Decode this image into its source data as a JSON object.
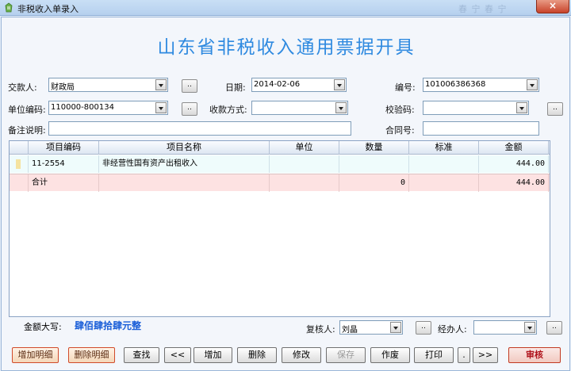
{
  "window": {
    "title": "非税收入单录入",
    "ghost_text": "春  宁  春  宁",
    "close_label": "×"
  },
  "header": {
    "title": "山东省非税收入通用票据开具"
  },
  "form": {
    "payer_label": "交款人:",
    "payer_value": "财政局",
    "date_label": "日期:",
    "date_value": "2014-02-06",
    "number_label": "编号:",
    "number_value": "101006386368",
    "unit_code_label": "单位编码:",
    "unit_code_value": "110000-800134",
    "pay_method_label": "收款方式:",
    "pay_method_value": "",
    "checksum_label": "校验码:",
    "checksum_value": "",
    "remark_label": "备注说明:",
    "remark_value": "",
    "contract_label": "合同号:",
    "contract_value": "",
    "dots": ".."
  },
  "grid": {
    "columns": [
      "项目编码",
      "项目名称",
      "单位",
      "数量",
      "标准",
      "金额"
    ],
    "row": {
      "marker": "I",
      "code": "11-2554",
      "name": "非经营性国有资产出租收入",
      "unit": "",
      "qty": "",
      "standard": "",
      "amount": "444.00"
    },
    "total": {
      "label": "合计",
      "qty": "0",
      "amount": "444.00"
    }
  },
  "summary": {
    "amount_upper_label": "金额大写:",
    "amount_upper_value": "肆佰肆拾肆元整",
    "reviewer_label": "复核人:",
    "reviewer_value": "刘晶",
    "handler_label": "经办人:",
    "handler_value": ""
  },
  "buttons": {
    "add_detail": "增加明细",
    "del_detail": "删除明细",
    "search": "查找",
    "first": "<<",
    "add": "增加",
    "delete": "删除",
    "edit": "修改",
    "save": "保存",
    "void": "作废",
    "print": "打印",
    "dot": ".",
    "last": ">>",
    "audit": "审核"
  }
}
